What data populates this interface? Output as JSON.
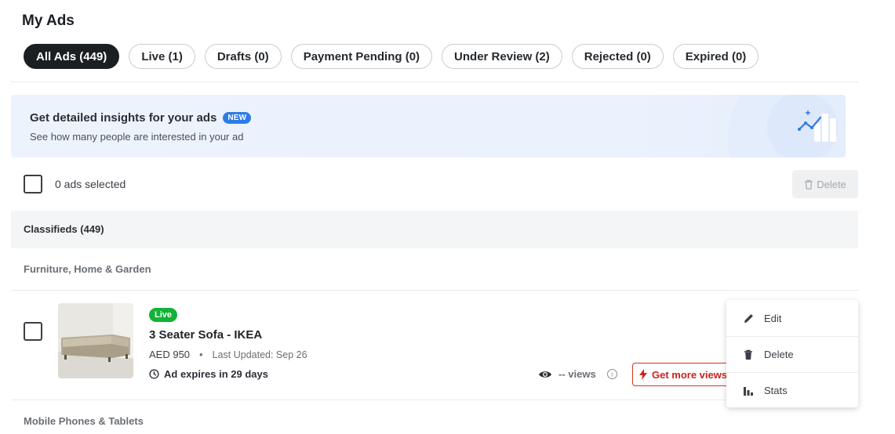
{
  "page": {
    "title": "My Ads"
  },
  "tabs": [
    {
      "label": "All Ads (449)",
      "active": true
    },
    {
      "label": "Live (1)"
    },
    {
      "label": "Drafts (0)"
    },
    {
      "label": "Payment Pending (0)"
    },
    {
      "label": "Under Review (2)"
    },
    {
      "label": "Rejected (0)"
    },
    {
      "label": "Expired (0)"
    }
  ],
  "banner": {
    "title": "Get detailed insights for your ads",
    "badge": "NEW",
    "subtitle": "See how many people are interested in your ad",
    "icon": "chart-sparkle-icon"
  },
  "selection": {
    "label": "0 ads selected",
    "delete_label": "Delete"
  },
  "section": {
    "title": "Classifieds (449)"
  },
  "categories": [
    "Furniture, Home & Garden",
    "Mobile Phones & Tablets"
  ],
  "ad": {
    "status": "Live",
    "title": "3 Seater Sofa - IKEA",
    "price": "AED 950",
    "updated": "Last Updated: Sep 26",
    "expiry": "Ad expires in 29 days",
    "views": "-- views",
    "boost_label": "Get more views"
  },
  "menu": {
    "items": [
      {
        "label": "Edit",
        "icon": "pencil-icon"
      },
      {
        "label": "Delete",
        "icon": "trash-icon"
      },
      {
        "label": "Stats",
        "icon": "bar-chart-icon"
      }
    ]
  },
  "colors": {
    "accent": "#2f7be5",
    "live": "#12b336",
    "boost": "#d2211b",
    "active_tab": "#1b1f24"
  }
}
